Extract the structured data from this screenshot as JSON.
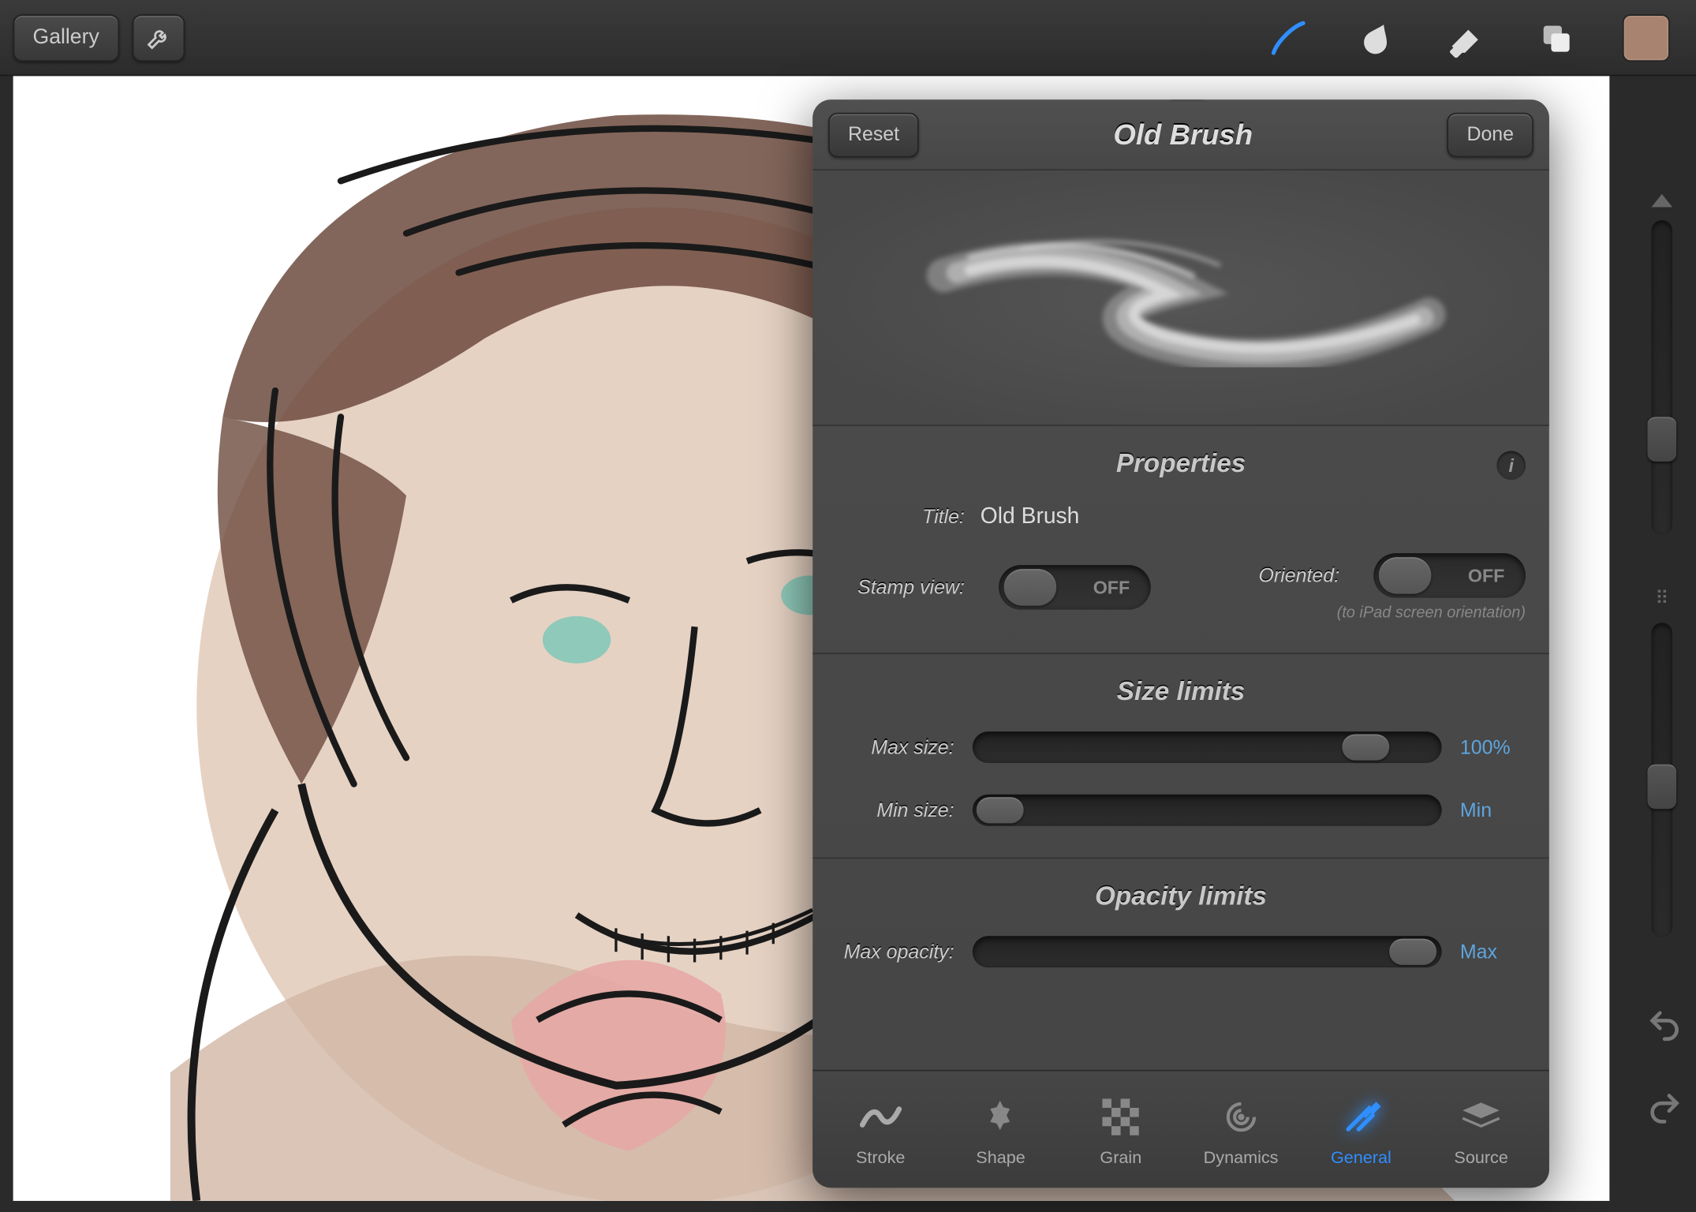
{
  "topbar": {
    "gallery_label": "Gallery"
  },
  "panel": {
    "reset_label": "Reset",
    "done_label": "Done",
    "title": "Old Brush",
    "properties": {
      "heading": "Properties",
      "title_label": "Title:",
      "title_value": "Old Brush",
      "stamp_label": "Stamp view:",
      "stamp_state": "OFF",
      "oriented_label": "Oriented:",
      "oriented_state": "OFF",
      "oriented_caption": "(to iPad screen orientation)"
    },
    "size_limits": {
      "heading": "Size limits",
      "max_label": "Max size:",
      "max_value": "100%",
      "min_label": "Min size:",
      "min_value": "Min"
    },
    "opacity_limits": {
      "heading": "Opacity limits",
      "max_label": "Max opacity:",
      "max_value": "Max"
    },
    "tabs": {
      "stroke": "Stroke",
      "shape": "Shape",
      "grain": "Grain",
      "dynamics": "Dynamics",
      "general": "General",
      "source": "Source"
    }
  },
  "colors": {
    "accent_blue": "#2f8fff",
    "link_blue": "#5ea5de",
    "swatch": "#a88470"
  }
}
